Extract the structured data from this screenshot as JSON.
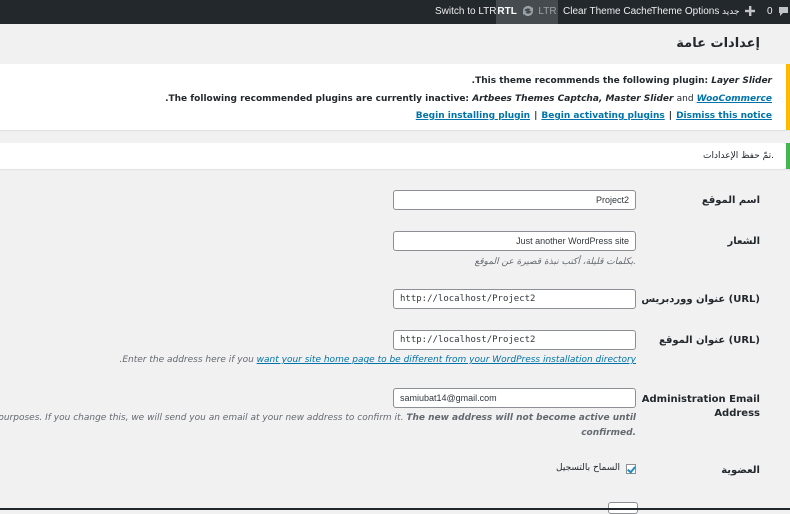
{
  "admin_bar": {
    "switch_ltr": "Switch to LTR",
    "rtl": "RTL",
    "ltr": "LTR",
    "clear_cache": "Clear Theme Cache",
    "theme_options": "Theme Options",
    "new_label": "جديد",
    "comments_count": "0"
  },
  "page_title": "إعدادات عامة",
  "notice": {
    "line1_text": "This theme recommends the following plugin:",
    "line1_plugin": "Layer Slider",
    "line1_end": ".",
    "line2_text": "The following recommended plugins are currently inactive:",
    "line2_plugins": "Artbees Themes Captcha, Master Slider",
    "line2_and": "and",
    "line2_link": "WooCommerce",
    "line2_end": ".",
    "begin_installing": "Begin installing plugin",
    "begin_activating": "Begin activating plugins",
    "dismiss": "Dismiss this notice",
    "separator": "|"
  },
  "saved_notice": "تمّ حفظ الإعدادات.",
  "form": {
    "site_title": {
      "label": "اسم الموقع",
      "value": "Project2"
    },
    "tagline": {
      "label": "الشعار",
      "value": "Just another WordPress site",
      "description": "بكلمات قليلة، أكتب نبذة قصيرة عن الموقع."
    },
    "wp_url": {
      "label": "عنوان ووردبريس (URL)",
      "value": "http://localhost/Project2"
    },
    "site_url": {
      "label": "عنوان الموقع (URL)",
      "value": "http://localhost/Project2",
      "desc_before": "Enter the address here if you",
      "desc_link": "want your site home page to be different from your WordPress installation directory",
      "desc_after": "."
    },
    "admin_email": {
      "label_line1": "Administration Email",
      "label_line2": "Address",
      "value": "samiubat14@gmail.com",
      "desc_line1_start": "admin purposes. If you change this, we will send you an email at your new address to confirm it.",
      "desc_line1_bold": "The new address will not become active until",
      "desc_line2": "confirmed."
    },
    "membership": {
      "label": "العضوية",
      "checkbox_label": "السماح بالتسجيل",
      "checked": true
    }
  },
  "colors": {
    "admin_bar": "#23282d",
    "warning_border": "#ffb900",
    "success_border": "#46b450",
    "link": "#0073aa"
  }
}
